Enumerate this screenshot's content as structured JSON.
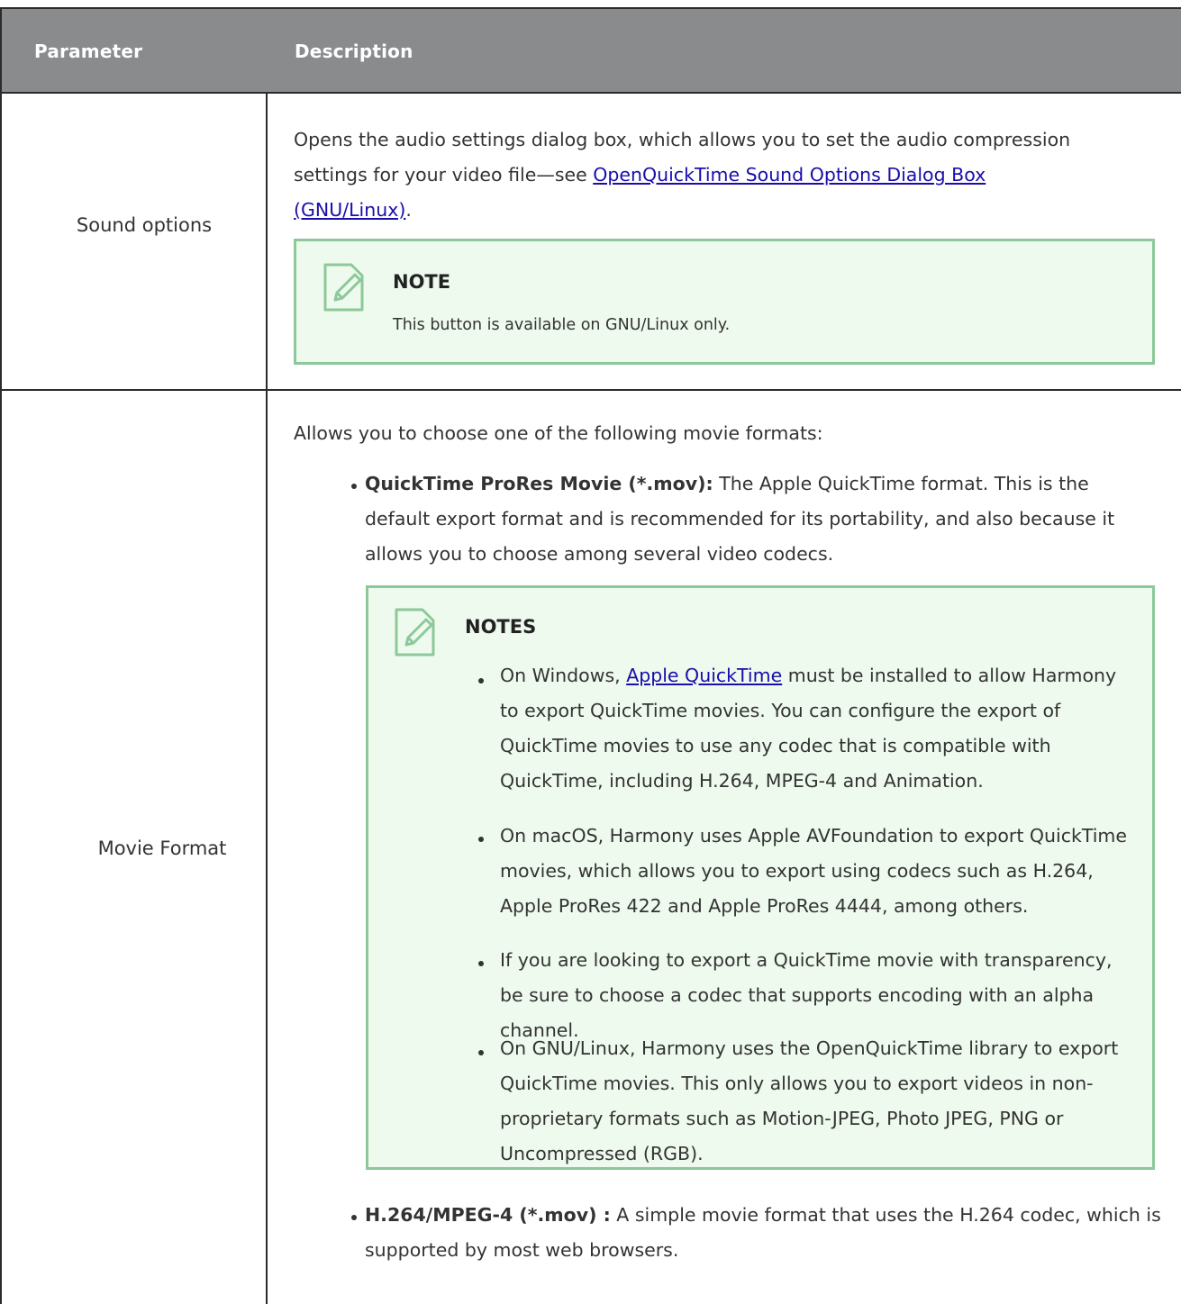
{
  "table": {
    "header": {
      "parameter": "Parameter",
      "description": "Description"
    },
    "rows": [
      {
        "parameter": "Sound options",
        "intro_before_link": "Opens the audio settings dialog box, which allows you to set the audio compression settings for your video file—see ",
        "link": "OpenQuickTime Sound Options Dialog Box (GNU/Linux)",
        "intro_after_link": ".",
        "note": {
          "title": "NOTE",
          "text": "This button is available on GNU/Linux only."
        }
      },
      {
        "parameter": "Movie Format",
        "intro": "Allows you to choose one of the following movie formats:",
        "formats": [
          {
            "term": "QuickTime ProRes Movie (*.mov):",
            "text": " The Apple QuickTime format. This is the default export format and is recommended for its portability, and also because it allows you to choose among several video codecs."
          },
          {
            "term": "H.264/MPEG-4 (*.mov) :",
            "text": " A simple movie format that uses the H.264 codec, which is supported by most web browsers."
          }
        ],
        "notes": {
          "title": "NOTES",
          "items": [
            {
              "before_link": "On Windows, ",
              "link": "Apple QuickTime",
              "after_link": " must be installed to allow Harmony to export QuickTime movies. You can configure the export of QuickTime movies to use any codec that is compatible with QuickTime, including H.264, MPEG-4 and Animation."
            },
            {
              "text": "On macOS, Harmony uses Apple AVFoundation to export QuickTime movies, which allows you to export using codecs such as H.264, Apple ProRes 422 and Apple ProRes 4444, among others."
            },
            {
              "text": "If you are looking to export a QuickTime movie with transparency, be sure to choose a codec that supports encoding with an alpha channel."
            },
            {
              "text": "On GNU/Linux, Harmony uses the OpenQuickTime library to export QuickTime movies. This only allows you to export videos in non-proprietary formats such as Motion-JPEG, Photo JPEG, PNG or Uncompressed (RGB)."
            }
          ]
        }
      }
    ]
  },
  "icons": {
    "note": "note-pencil-icon"
  },
  "colors": {
    "header_bg": "#8a8b8d",
    "note_bg": "#eefaee",
    "note_border": "#8dc89a",
    "link": "#1a0dab"
  }
}
